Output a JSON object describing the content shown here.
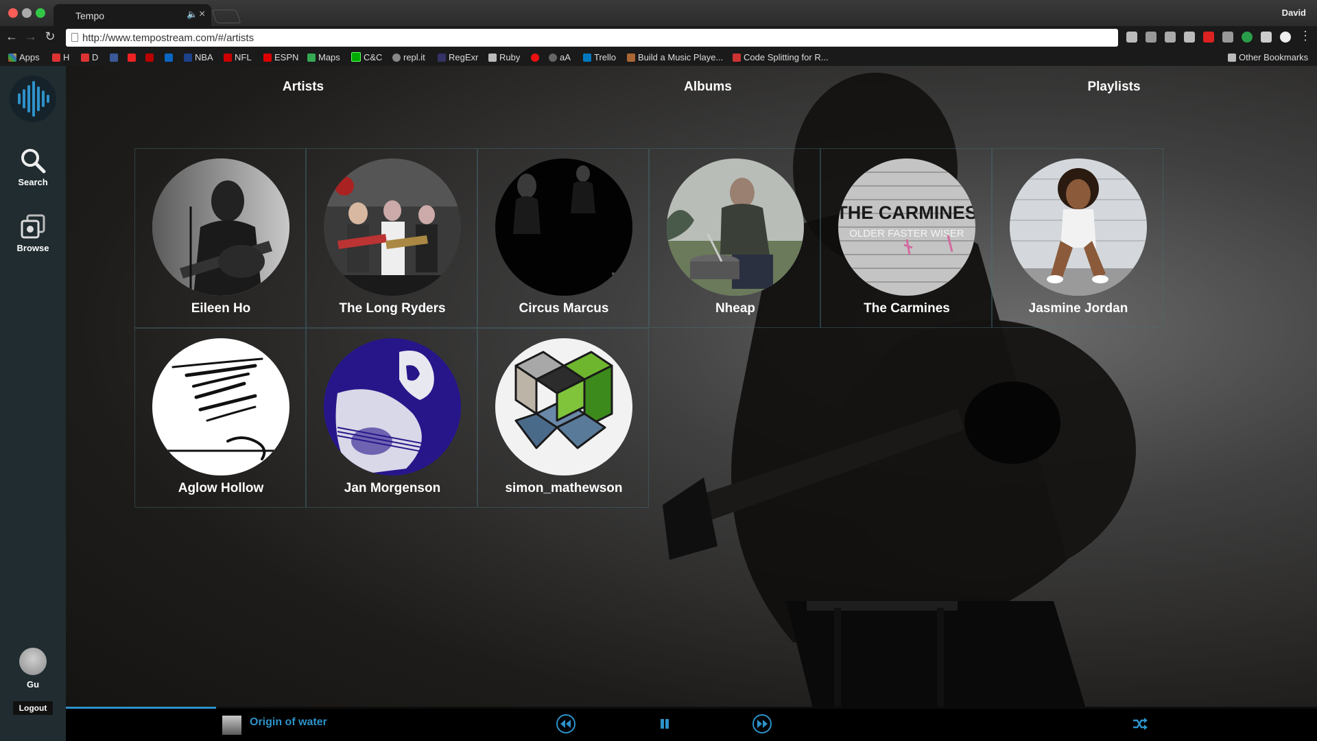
{
  "browser": {
    "tab_title": "Tempo",
    "profile": "David",
    "url": "http://www.tempostream.com/#/artists",
    "bookmarks": [
      "Apps",
      "H",
      "D",
      "NBA",
      "NFL",
      "ESPN",
      "Maps",
      "C&C",
      "repl.it",
      "RegExr",
      "Ruby",
      "aA",
      "Trello",
      "Build a Music Playe...",
      "Code Splitting for R..."
    ],
    "other_bookmarks": "Other Bookmarks"
  },
  "sidebar": {
    "search_label": "Search",
    "browse_label": "Browse",
    "user_name": "Gu",
    "logout_label": "Logout"
  },
  "nav": {
    "artists": "Artists",
    "albums": "Albums",
    "playlists": "Playlists"
  },
  "artists": [
    {
      "name": "Eileen Ho"
    },
    {
      "name": "The Long Ryders"
    },
    {
      "name": "Circus Marcus"
    },
    {
      "name": "Nheap"
    },
    {
      "name": "The Carmines"
    },
    {
      "name": "Jasmine Jordan"
    },
    {
      "name": "Aglow Hollow"
    },
    {
      "name": "Jan Morgenson"
    },
    {
      "name": "simon_mathewson"
    }
  ],
  "album_art_text": {
    "carmines_title": "THE CARMINES",
    "carmines_subtitle": "OLDER FASTER WISER"
  },
  "player": {
    "song_title": "Origin of water",
    "progress": 0.12
  },
  "colors": {
    "accent": "#2d92c9",
    "sidebar": "#212c30"
  }
}
